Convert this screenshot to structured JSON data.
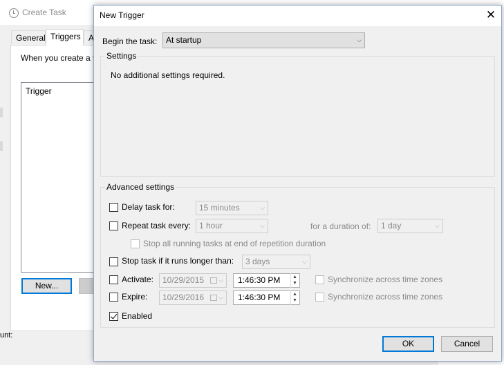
{
  "background_window": {
    "title": "Create Task",
    "tabs": [
      "General",
      "Triggers",
      "A"
    ],
    "description": "When you create a t",
    "list_header": "Trigger",
    "new_button": "New...",
    "bottom_text": "unt:"
  },
  "dialog": {
    "title": "New Trigger",
    "begin_label": "Begin the task:",
    "begin_value": "At startup",
    "settings_title": "Settings",
    "settings_message": "No additional settings required.",
    "advanced_title": "Advanced settings",
    "delay": {
      "label": "Delay task for:",
      "value": "15 minutes",
      "checked": false
    },
    "repeat": {
      "label": "Repeat task every:",
      "value": "1 hour",
      "duration_label": "for a duration of:",
      "duration_value": "1 day",
      "checked": false
    },
    "stop_running": {
      "label": "Stop all running tasks at end of repetition duration",
      "checked": false
    },
    "stop_longer": {
      "label": "Stop task if it runs longer than:",
      "value": "3 days",
      "checked": false
    },
    "activate": {
      "label": "Activate:",
      "date": "10/29/2015",
      "time": "1:46:30 PM",
      "sync_label": "Synchronize across time zones",
      "checked": false
    },
    "expire": {
      "label": "Expire:",
      "date": "10/29/2016",
      "time": "1:46:30 PM",
      "sync_label": "Synchronize across time zones",
      "checked": false
    },
    "enabled": {
      "label": "Enabled",
      "checked": true
    },
    "ok_label": "OK",
    "cancel_label": "Cancel",
    "close_glyph": "✕"
  },
  "icons": {
    "dropdown": "chevron-down-icon",
    "close": "close-icon",
    "clock": "clock-icon",
    "calendar": "calendar-icon",
    "spin": "spin-arrows-icon"
  },
  "colors": {
    "accent": "#0078d7",
    "dialog_bg": "#f0f0f0",
    "disabled_text": "#8a8a8a"
  }
}
